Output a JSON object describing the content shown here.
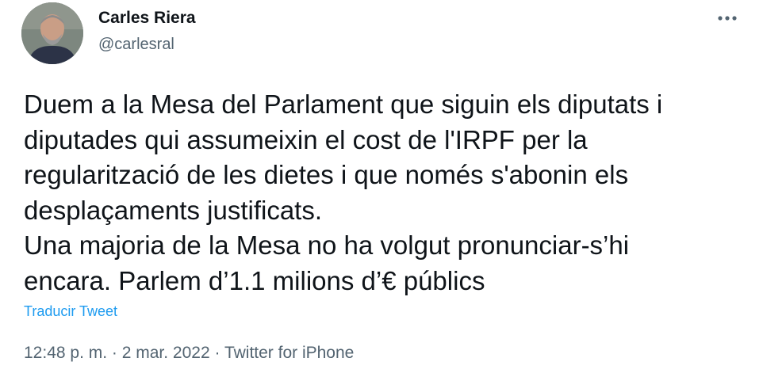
{
  "author": {
    "name": "Carles Riera",
    "handle": "@carlesral"
  },
  "tweet": {
    "text": "Duem a la Mesa del Parlament que siguin els diputats i\ndiputades qui assumeixin el cost de l'IRPF per la\nregularització de les dietes i que només s'abonin els\ndesplaçaments justificats.\nUna majoria de la Mesa no ha volgut pronunciar-s’hi\nencara. Parlem d’1.1 milions d’€ públics",
    "translate_label": "Traducir Tweet"
  },
  "meta": {
    "time": "12:48 p. m.",
    "separator": " · ",
    "date": "2 mar. 2022",
    "source": "Twitter for iPhone"
  },
  "icons": {
    "more": "more-horizontal-icon",
    "avatar": "profile-photo"
  }
}
